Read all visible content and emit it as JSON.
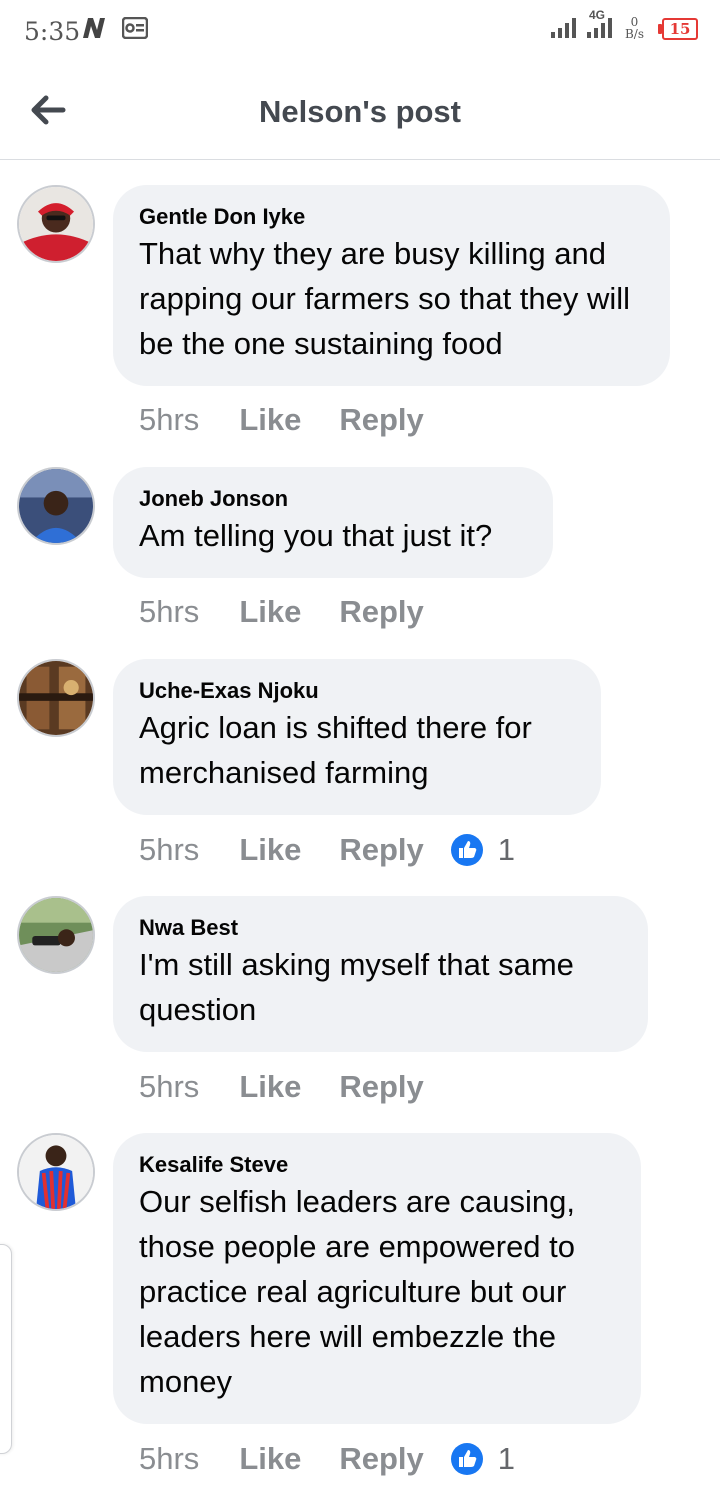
{
  "status_bar": {
    "time": "5:35",
    "network": "4G",
    "data_speed_value": "0",
    "data_speed_unit": "B/s",
    "battery": "15",
    "battery_color": "#e53935",
    "icons": [
      "n-notification-icon",
      "cast-icon",
      "signal-icon",
      "signal-4g-icon",
      "battery-icon"
    ]
  },
  "header": {
    "title": "Nelson's post",
    "back_icon": "arrow-left-icon"
  },
  "colors": {
    "bubble": "#f0f2f5",
    "muted_text": "#8a8d91",
    "like_blue": "#1877f2"
  },
  "comments": [
    {
      "author": "Gentle Don Iyke",
      "text": "That why they are busy killing and rapping our farmers so that they will be the one sustaining food",
      "time": "5hrs",
      "like_label": "Like",
      "reply_label": "Reply",
      "reactions": null
    },
    {
      "author": "Joneb Jonson",
      "text": "Am telling you that just it?",
      "time": "5hrs",
      "like_label": "Like",
      "reply_label": "Reply",
      "reactions": null
    },
    {
      "author": "Uche-Exas Njoku",
      "text": "Agric loan is shifted there for merchanised farming",
      "time": "5hrs",
      "like_label": "Like",
      "reply_label": "Reply",
      "reactions": "1"
    },
    {
      "author": "Nwa Best",
      "text": "I'm still asking myself that same question",
      "time": "5hrs",
      "like_label": "Like",
      "reply_label": "Reply",
      "reactions": null
    },
    {
      "author": "Kesalife Steve",
      "text": "Our selfish leaders are causing, those people are empowered to practice real agriculture but our leaders here will embezzle the money",
      "time": "5hrs",
      "like_label": "Like",
      "reply_label": "Reply",
      "reactions": "1"
    }
  ]
}
